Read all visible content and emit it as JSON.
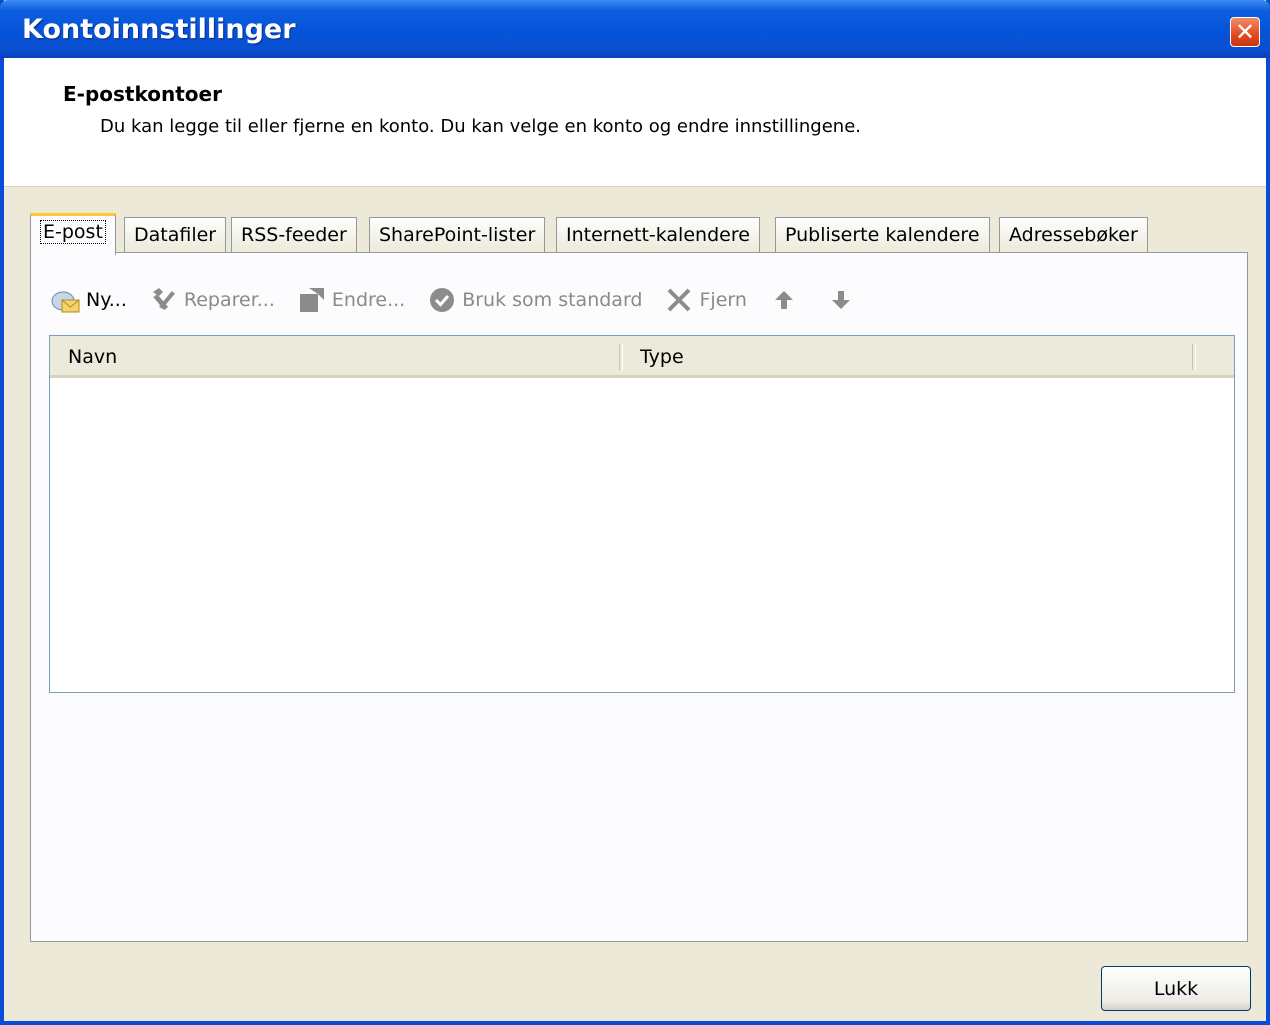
{
  "window": {
    "title": "Kontoinnstillinger"
  },
  "header": {
    "title": "E-postkontoer",
    "subtitle": "Du kan legge til eller fjerne en konto. Du kan velge en konto og endre innstillingene."
  },
  "tabs": [
    {
      "label": "E-post",
      "active": true
    },
    {
      "label": "Datafiler"
    },
    {
      "label": "RSS-feeder"
    },
    {
      "label": "SharePoint-lister"
    },
    {
      "label": "Internett-kalendere"
    },
    {
      "label": "Publiserte kalendere"
    },
    {
      "label": "Adressebøker"
    }
  ],
  "toolbar": {
    "new": {
      "label": "Ny...",
      "enabled": true,
      "icon": "new-account-icon"
    },
    "repair": {
      "label": "Reparer...",
      "enabled": false,
      "icon": "tools-icon"
    },
    "change": {
      "label": "Endre...",
      "enabled": false,
      "icon": "change-icon"
    },
    "set_default": {
      "label": "Bruk som standard",
      "enabled": false,
      "icon": "checkmark-icon"
    },
    "remove": {
      "label": "Fjern",
      "enabled": false,
      "icon": "remove-icon"
    },
    "move_up": {
      "icon": "arrow-up-icon",
      "enabled": false
    },
    "move_down": {
      "icon": "arrow-down-icon",
      "enabled": false
    }
  },
  "list": {
    "columns": [
      "Navn",
      "Type"
    ],
    "rows": []
  },
  "footer": {
    "close_label": "Lukk"
  },
  "colors": {
    "titlebar": "#0553d9",
    "dialog_bg": "#ece9d8",
    "active_tab_accent": "#ffc83c"
  }
}
